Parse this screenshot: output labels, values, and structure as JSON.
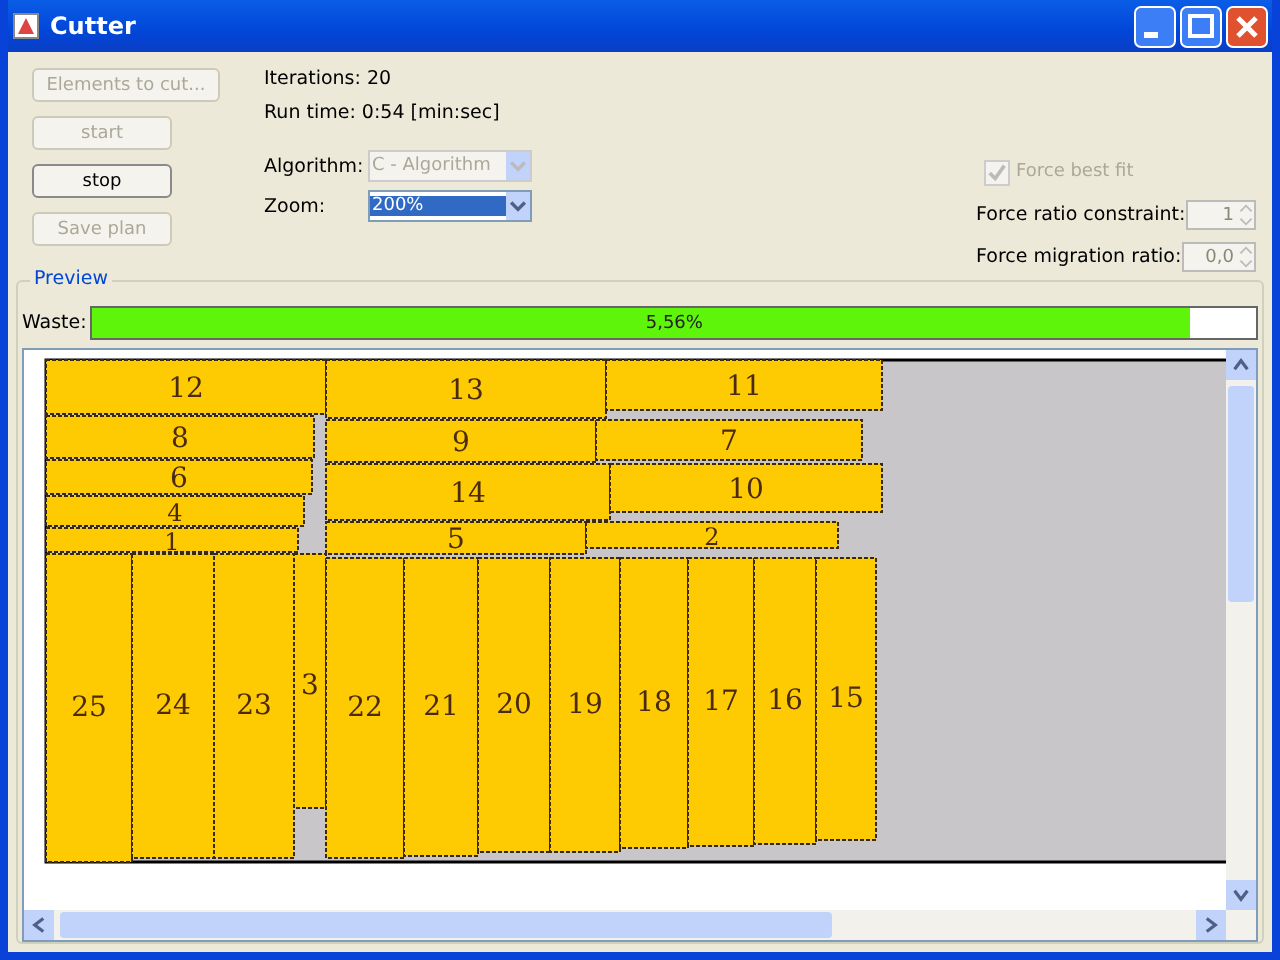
{
  "window": {
    "title": "Cutter"
  },
  "buttons": [
    {
      "label": "Elements to cut...",
      "disabled": true
    },
    {
      "label": "start",
      "disabled": true
    },
    {
      "label": "stop",
      "disabled": false
    },
    {
      "label": "Save plan",
      "disabled": true
    }
  ],
  "stats": [
    "Iterations: 20",
    "Run time: 0:54 [min:sec]"
  ],
  "combos": [
    {
      "label": "Algorithm:",
      "value": "C - Algorithm",
      "disabled": true,
      "selected": false
    },
    {
      "label": "Zoom:",
      "value": "200%",
      "disabled": false,
      "selected": true
    }
  ],
  "force_best_fit": {
    "label": "Force best fit",
    "checked": true,
    "disabled": true
  },
  "spinners": [
    {
      "label": "Force ratio constraint:",
      "value": "1",
      "disabled": true
    },
    {
      "label": "Force migration ratio:",
      "value": "0,0",
      "disabled": true
    }
  ],
  "preview": {
    "title": "Preview",
    "waste_label": "Waste:",
    "waste": {
      "level": 0.944,
      "reading": "5,56%"
    }
  },
  "pieces": [
    "12",
    "13",
    "11",
    "8",
    "9",
    "7",
    "6",
    "4",
    "14",
    "10",
    "1",
    "5",
    "2",
    "25",
    "24",
    "23",
    "3",
    "22",
    "21",
    "20",
    "19",
    "18",
    "17",
    "16",
    "15"
  ]
}
